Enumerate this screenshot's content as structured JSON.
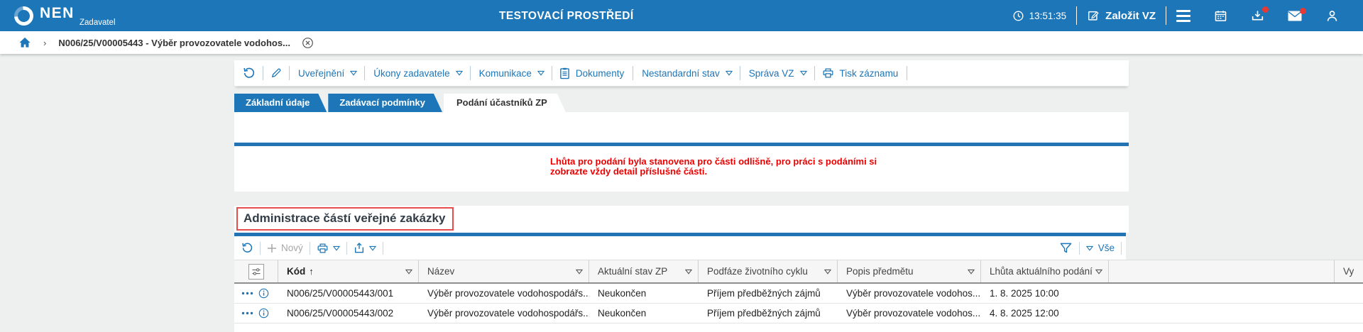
{
  "topbar": {
    "logo": "NEN",
    "logo_sub": "Zadavatel",
    "env_title": "TESTOVACÍ PROSTŘEDÍ",
    "time": "13:51:35",
    "create_button": "Založit VZ"
  },
  "breadcrumb": {
    "record": "N006/25/V00005443 - Výběr provozovatele vodohos..."
  },
  "record_toolbar": {
    "items": [
      {
        "label": "Uveřejnění"
      },
      {
        "label": "Úkony zadavatele"
      },
      {
        "label": "Komunikace"
      },
      {
        "label": "Dokumenty"
      },
      {
        "label": "Nestandardní stav"
      },
      {
        "label": "Správa VZ"
      },
      {
        "label": "Tisk záznamu"
      }
    ]
  },
  "tabs": [
    {
      "label": "Základní údaje",
      "active": false
    },
    {
      "label": "Zadávací podmínky",
      "active": false
    },
    {
      "label": "Podání účastníků ZP",
      "active": true
    }
  ],
  "warning": {
    "lines": [
      "Lhůta pro podání byla stanovena pro části odlišně, pro práci s podáními si",
      "zobrazte vždy detail příslušné části."
    ]
  },
  "section_title": "Administrace částí veřejné zakázky",
  "grid_toolbar": {
    "new_label": "Nový",
    "all_label": "Vše"
  },
  "table": {
    "columns": [
      {
        "label": ""
      },
      {
        "label": "Kód",
        "sorted": "asc"
      },
      {
        "label": "Název"
      },
      {
        "label": "Aktuální stav ZP"
      },
      {
        "label": "Podfáze životního cyklu"
      },
      {
        "label": "Popis předmětu"
      },
      {
        "label": "Lhůta aktuálního podání"
      },
      {
        "label": ""
      },
      {
        "label": "Vy"
      }
    ],
    "rows": [
      {
        "kod": "N006/25/V00005443/001",
        "nazev": "Výběr provozovatele vodohospodářs...",
        "stav": "Neukončen",
        "podfaze": "Příjem předběžných zájmů",
        "popis": "Výběr provozovatele vodohos...",
        "lhuta": "1. 8. 2025 10:00"
      },
      {
        "kod": "N006/25/V00005443/002",
        "nazev": "Výběr provozovatele vodohospodářs...",
        "stav": "Neukončen",
        "podfaze": "Příjem předběžných zájmů",
        "popis": "Výběr provozovatele vodohos...",
        "lhuta": "4. 8. 2025 12:00"
      }
    ]
  },
  "colors": {
    "brand_blue": "#1c76b8",
    "bar_blue": "#2173b4",
    "warning_red": "#ee0000",
    "highlight_red_border": "#e84c4c",
    "badge_red": "#e53935",
    "disabled_gray": "#a7a7a7"
  }
}
